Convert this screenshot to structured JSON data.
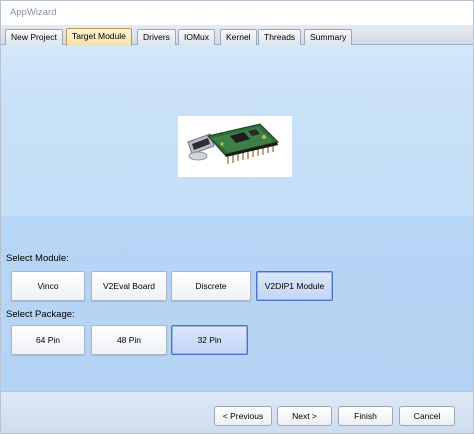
{
  "window": {
    "title": "AppWizard"
  },
  "tabs": [
    {
      "label": "New Project"
    },
    {
      "label": "Target Module",
      "active": true
    },
    {
      "label": "Drivers"
    },
    {
      "label": "IOMux"
    },
    {
      "label": "Kernel"
    },
    {
      "label": "Threads"
    },
    {
      "label": "Summary"
    }
  ],
  "module_section": {
    "label": "Select Module:",
    "options": [
      "Vinco",
      "V2Eval Board",
      "Discrete",
      "V2DIP1 Module"
    ],
    "selected": "V2DIP1 Module"
  },
  "package_section": {
    "label": "Select Package:",
    "options": [
      "64 Pin",
      "48 Pin",
      "32 Pin"
    ],
    "selected": "32 Pin"
  },
  "footer": {
    "previous": "< Previous",
    "next": "Next >",
    "finish": "Finish",
    "cancel": "Cancel"
  },
  "colors": {
    "content_bg": "#c8e0f8",
    "selected_border": "#4a6fc8",
    "active_tab": "#f3dfa7"
  },
  "icons": {
    "module_photo": "board-image"
  }
}
